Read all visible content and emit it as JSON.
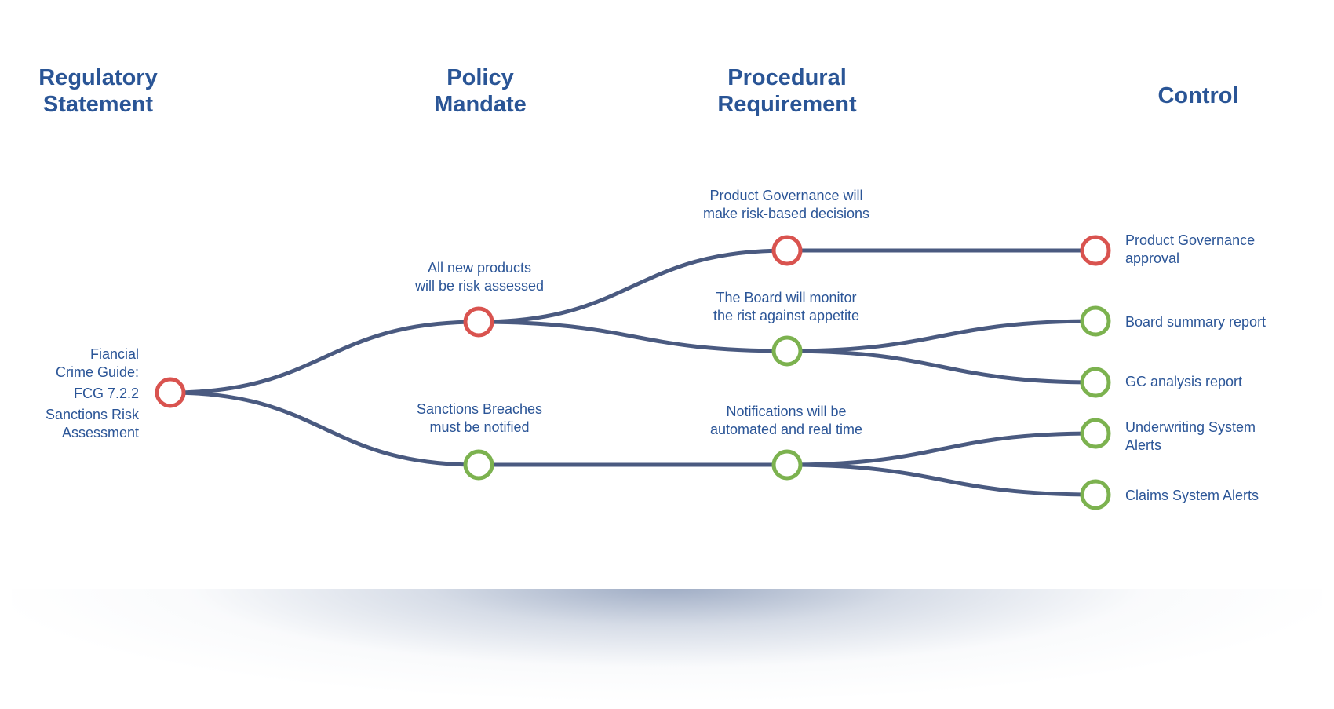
{
  "colors": {
    "heading": "#2a5596",
    "text": "#2b5597",
    "link": "#4a5a80",
    "node_red": "#d9534f",
    "node_green": "#7cb24f"
  },
  "columns": [
    {
      "id": "regulatory",
      "title_line1": "Regulatory",
      "title_line2": "Statement"
    },
    {
      "id": "policy",
      "title_line1": "Policy",
      "title_line2": "Mandate"
    },
    {
      "id": "procedural",
      "title_line1": "Procedural",
      "title_line2": "Requirement"
    },
    {
      "id": "control",
      "title_line1": "Control",
      "title_line2": ""
    }
  ],
  "nodes": {
    "reg": {
      "status": "red",
      "lines": [
        "Fiancial",
        "Crime Guide:",
        "FCG 7.2.2",
        "Sanctions Risk",
        "Assessment"
      ]
    },
    "pol_new_products": {
      "status": "red",
      "lines": [
        "All new products",
        "will be risk assessed"
      ]
    },
    "pol_sanctions": {
      "status": "green",
      "lines": [
        "Sanctions Breaches",
        "must be notified"
      ]
    },
    "proc_governance": {
      "status": "red",
      "lines": [
        "Product Governance will",
        "make risk-based decisions"
      ]
    },
    "proc_board": {
      "status": "green",
      "lines": [
        "The Board will monitor",
        "the rist against appetite"
      ]
    },
    "proc_notifications": {
      "status": "green",
      "lines": [
        "Notifications will be",
        "automated and real time"
      ]
    },
    "ctrl_pg_approval": {
      "status": "red",
      "lines": [
        "Product Governance",
        "approval"
      ]
    },
    "ctrl_board_summary": {
      "status": "green",
      "lines": [
        "Board summary report"
      ]
    },
    "ctrl_gc_analysis": {
      "status": "green",
      "lines": [
        "GC analysis report"
      ]
    },
    "ctrl_underwriting": {
      "status": "green",
      "lines": [
        "Underwriting System",
        "Alerts"
      ]
    },
    "ctrl_claims": {
      "status": "green",
      "lines": [
        "Claims System Alerts"
      ]
    }
  },
  "links": [
    {
      "from": "reg",
      "to": "pol_new_products"
    },
    {
      "from": "reg",
      "to": "pol_sanctions"
    },
    {
      "from": "pol_new_products",
      "to": "proc_governance"
    },
    {
      "from": "pol_new_products",
      "to": "proc_board"
    },
    {
      "from": "pol_sanctions",
      "to": "proc_notifications"
    },
    {
      "from": "proc_governance",
      "to": "ctrl_pg_approval"
    },
    {
      "from": "proc_board",
      "to": "ctrl_board_summary"
    },
    {
      "from": "proc_board",
      "to": "ctrl_gc_analysis"
    },
    {
      "from": "proc_notifications",
      "to": "ctrl_underwriting"
    },
    {
      "from": "proc_notifications",
      "to": "ctrl_claims"
    }
  ]
}
